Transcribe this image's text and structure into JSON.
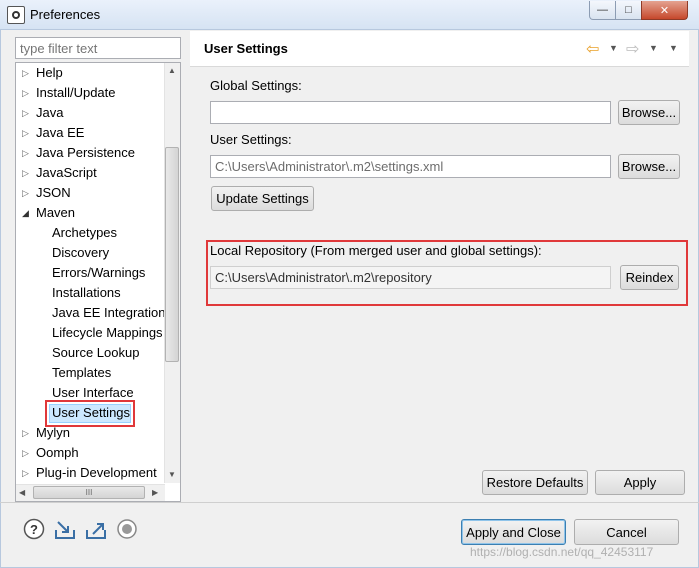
{
  "window": {
    "title": "Preferences",
    "min_glyph": "—",
    "max_glyph": "□",
    "close_glyph": "✕"
  },
  "filter": {
    "placeholder": "type filter text"
  },
  "tree": {
    "items": [
      {
        "label": "Help",
        "expanded": false
      },
      {
        "label": "Install/Update",
        "expanded": false
      },
      {
        "label": "Java",
        "expanded": false
      },
      {
        "label": "Java EE",
        "expanded": false
      },
      {
        "label": "Java Persistence",
        "expanded": false
      },
      {
        "label": "JavaScript",
        "expanded": false
      },
      {
        "label": "JSON",
        "expanded": false
      },
      {
        "label": "Maven",
        "expanded": true
      },
      {
        "label": "Mylyn",
        "expanded": false
      },
      {
        "label": "Oomph",
        "expanded": false
      },
      {
        "label": "Plug-in Development",
        "expanded": false
      }
    ],
    "maven_children": [
      "Archetypes",
      "Discovery",
      "Errors/Warnings",
      "Installations",
      "Java EE Integration",
      "Lifecycle Mappings",
      "Source Lookup",
      "Templates",
      "User Interface",
      "User Settings"
    ],
    "selected": "User Settings",
    "hscroll_grip": "III"
  },
  "page": {
    "title": "User Settings",
    "global_settings_label": "Global Settings:",
    "global_settings_value": "",
    "user_settings_label": "User Settings:",
    "user_settings_value": "C:\\Users\\Administrator\\.m2\\settings.xml",
    "browse_label": "Browse...",
    "update_settings_label": "Update Settings",
    "local_repo_label": "Local Repository (From merged user and global settings):",
    "local_repo_value": "C:\\Users\\Administrator\\.m2\\repository",
    "reindex_label": "Reindex",
    "restore_defaults_label": "Restore Defaults",
    "apply_label": "Apply"
  },
  "footer": {
    "apply_close_label": "Apply and Close",
    "cancel_label": "Cancel",
    "watermark": "https://blog.csdn.net/qq_42453117"
  },
  "colors": {
    "highlight_box": "#e0383a",
    "selection": "#cce8ff",
    "nav_arrow": "#e9a12b"
  }
}
